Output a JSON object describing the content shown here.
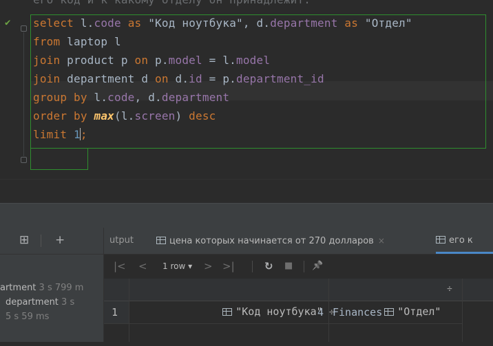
{
  "editor": {
    "faded_line": "его код и к какому отделу он принадлежит.",
    "lines": [
      {
        "tokens": [
          {
            "t": "select ",
            "c": "k"
          },
          {
            "t": "l.",
            "c": "tx"
          },
          {
            "t": "code",
            "c": "f"
          },
          {
            "t": " as ",
            "c": "k"
          },
          {
            "t": "\"Код ноутбука\"",
            "c": "tx"
          },
          {
            "t": ", ",
            "c": "tx"
          },
          {
            "t": "d.",
            "c": "tx"
          },
          {
            "t": "department",
            "c": "f"
          },
          {
            "t": " as ",
            "c": "k"
          },
          {
            "t": "\"Отдел\"",
            "c": "tx"
          }
        ]
      },
      {
        "tokens": [
          {
            "t": "from ",
            "c": "k"
          },
          {
            "t": "laptop l",
            "c": "tx"
          }
        ]
      },
      {
        "tokens": [
          {
            "t": "join ",
            "c": "k"
          },
          {
            "t": "product p ",
            "c": "tx"
          },
          {
            "t": "on ",
            "c": "k"
          },
          {
            "t": "p.",
            "c": "tx"
          },
          {
            "t": "model",
            "c": "f"
          },
          {
            "t": " = ",
            "c": "tx"
          },
          {
            "t": "l.",
            "c": "tx"
          },
          {
            "t": "model",
            "c": "f"
          }
        ]
      },
      {
        "tokens": [
          {
            "t": "join ",
            "c": "k"
          },
          {
            "t": "department d ",
            "c": "tx"
          },
          {
            "t": "on ",
            "c": "k"
          },
          {
            "t": "d.",
            "c": "tx"
          },
          {
            "t": "id",
            "c": "f"
          },
          {
            "t": " = ",
            "c": "tx"
          },
          {
            "t": "p.",
            "c": "tx"
          },
          {
            "t": "department_id",
            "c": "f"
          }
        ]
      },
      {
        "tokens": [
          {
            "t": "group by ",
            "c": "k"
          },
          {
            "t": "l.",
            "c": "tx"
          },
          {
            "t": "code",
            "c": "f"
          },
          {
            "t": ", ",
            "c": "tx"
          },
          {
            "t": "d.",
            "c": "tx"
          },
          {
            "t": "department",
            "c": "f"
          }
        ]
      },
      {
        "tokens": [
          {
            "t": "order by ",
            "c": "k"
          },
          {
            "t": "max",
            "c": "fn"
          },
          {
            "t": "(l.",
            "c": "tx"
          },
          {
            "t": "screen",
            "c": "f"
          },
          {
            "t": ") ",
            "c": "tx"
          },
          {
            "t": "desc",
            "c": "k"
          }
        ]
      },
      {
        "tokens": [
          {
            "t": "limit ",
            "c": "k"
          },
          {
            "t": "1",
            "c": "n"
          },
          {
            "t": ";",
            "c": "k"
          }
        ]
      }
    ]
  },
  "services": {
    "left_toolbar": {
      "pin_label": "⊞",
      "add_label": "+"
    },
    "left_items": [
      {
        "name": "artment",
        "duration": " 3 s 799 m"
      },
      {
        "name": "department",
        "duration": " 3 s"
      },
      {
        "name": "",
        "duration": "5 s 59 ms"
      }
    ],
    "tabs": {
      "output_label": "utput",
      "result_tab_label": "цена которых начинается от 270 долларов",
      "next_tab_label": "его к",
      "close_label": "×"
    },
    "result_toolbar": {
      "first": "|<",
      "prev": "<",
      "rows_label": "1 row ▾",
      "next": ">",
      "last": ">|",
      "refresh": "↻",
      "stop": "■",
      "pin": "📌"
    },
    "grid": {
      "columns": [
        "\"Код ноутбука\"",
        "\"Отдел\""
      ],
      "sort_glyph": "÷",
      "rows": [
        {
          "num": "1",
          "code": "4",
          "department": "Finances"
        }
      ]
    }
  },
  "colors": {
    "keyword": "#cc7832",
    "field": "#9876aa",
    "number": "#6897bb",
    "text": "#a9b7c6",
    "scope_border": "#2f8f2f",
    "active_tab": "#4a88c7"
  }
}
